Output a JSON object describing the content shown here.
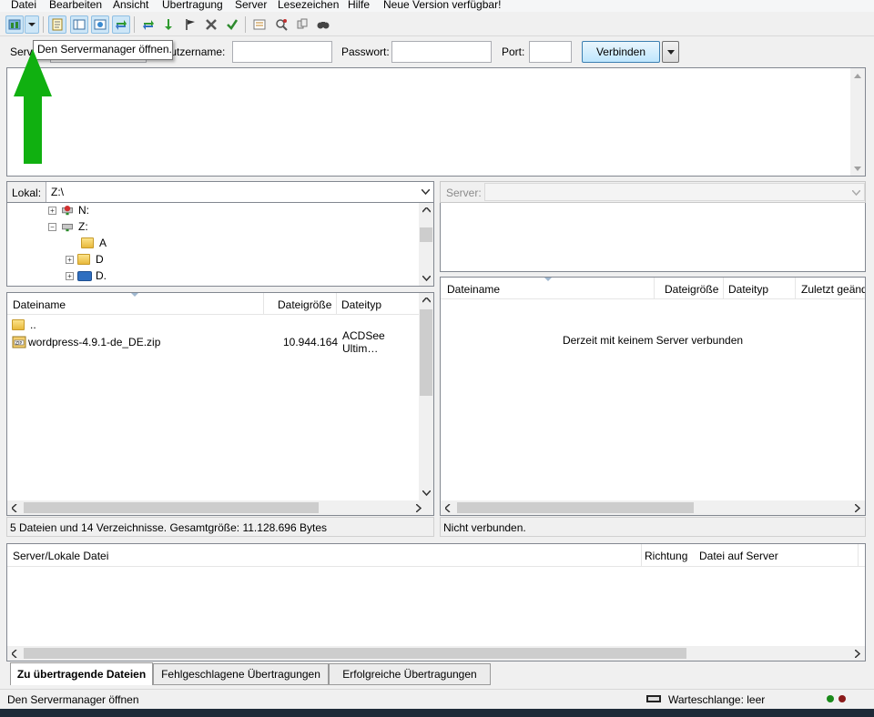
{
  "menu": [
    "Datei",
    "Bearbeiten",
    "Ansicht",
    "Übertragung",
    "Server",
    "Lesezeichen",
    "Hilfe",
    "Neue Version verfügbar!"
  ],
  "toolbar": {
    "icons": [
      "site-manager-icon",
      "site-manager-dropdown-icon",
      "message-log-icon",
      "local-tree-icon",
      "remote-tree-icon",
      "transfer-queue-icon",
      "refresh-icon",
      "process-queue-icon",
      "cancel-operation-icon",
      "disconnect-icon",
      "reconnect-icon",
      "directory-filter-icon",
      "compare-icon",
      "sync-browse-icon",
      "search-icon"
    ]
  },
  "tooltip": "Den Servermanager öffnen.",
  "quickconnect": {
    "server_label": "Server:",
    "username_label": "Benutzername:",
    "password_label": "Passwort:",
    "port_label": "Port:",
    "connect_label": "Verbinden",
    "server_value": "",
    "username_value": "",
    "password_value": "",
    "port_value": ""
  },
  "local": {
    "path_label": "Lokal:",
    "path_value": "Z:\\",
    "tree": [
      {
        "label": "N:",
        "icon": "network-drive-icon"
      },
      {
        "label": "Z:",
        "icon": "network-drive-icon"
      },
      {
        "label": "A",
        "icon": "folder-icon"
      },
      {
        "label": "D",
        "icon": "folder-icon"
      },
      {
        "label": "D.",
        "icon": "drive-icon"
      }
    ],
    "columns": [
      "Dateiname",
      "Dateigröße",
      "Dateityp"
    ],
    "rows": [
      {
        "name": "..",
        "size": "",
        "type": "",
        "icon": "folder-icon"
      },
      {
        "name": "wordpress-4.9.1-de_DE.zip",
        "size": "10.944.164",
        "type": "ACDSee Ultim…",
        "icon": "zip-icon"
      }
    ],
    "status": "5 Dateien und 14 Verzeichnisse. Gesamtgröße: 11.128.696 Bytes"
  },
  "remote": {
    "path_label": "Server:",
    "path_value": "",
    "columns": [
      "Dateiname",
      "Dateigröße",
      "Dateityp",
      "Zuletzt geänd"
    ],
    "empty_message": "Derzeit mit keinem Server verbunden",
    "status": "Nicht verbunden."
  },
  "queue": {
    "columns": [
      "Server/Lokale Datei",
      "Richtung",
      "Datei auf Server"
    ]
  },
  "tabs": [
    "Zu übertragende Dateien",
    "Fehlgeschlagene Übertragungen",
    "Erfolgreiche Übertragungen"
  ],
  "statusbar": {
    "message": "Den Servermanager öffnen",
    "queue": "Warteschlange: leer"
  },
  "colors": {
    "arrow_green": "#10b010",
    "led_green": "#1a8a1a",
    "led_red": "#8a1a1a"
  }
}
